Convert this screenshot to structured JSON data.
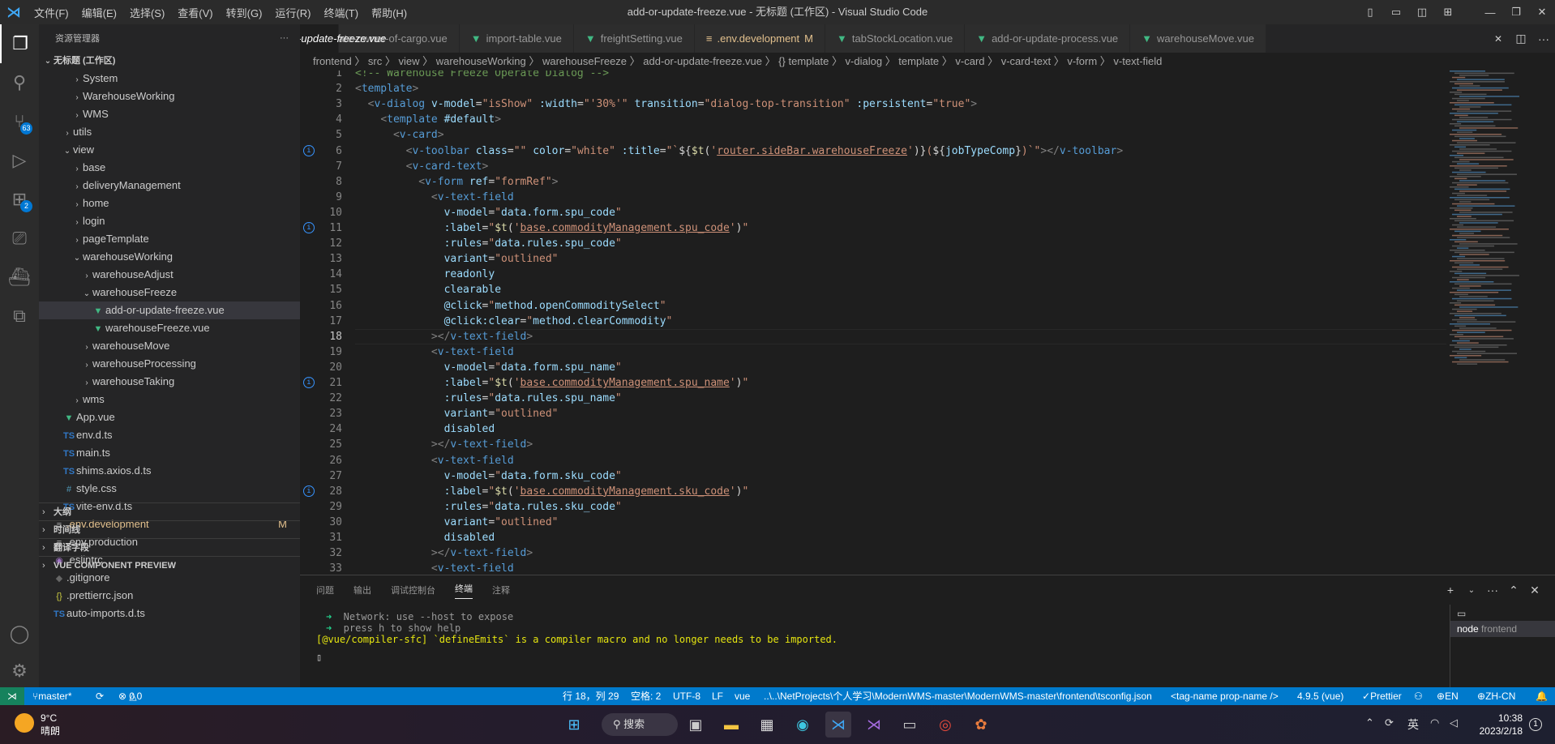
{
  "title": {
    "window": "add-or-update-freeze.vue - 无标题 (工作区) - Visual Studio Code",
    "menus": [
      "文件(F)",
      "编辑(E)",
      "选择(S)",
      "查看(V)",
      "转到(G)",
      "运行(R)",
      "终端(T)",
      "帮助(H)"
    ]
  },
  "activity": {
    "scm_badge": "63",
    "ext_badge": "2"
  },
  "sidebar": {
    "header": "资源管理器",
    "workspace": "无标题 (工作区)",
    "tree": [
      {
        "label": "System",
        "depth": 3,
        "type": "folder",
        "open": false
      },
      {
        "label": "WarehouseWorking",
        "depth": 3,
        "type": "folder",
        "open": false
      },
      {
        "label": "WMS",
        "depth": 3,
        "type": "folder",
        "open": false
      },
      {
        "label": "utils",
        "depth": 2,
        "type": "folder",
        "open": false
      },
      {
        "label": "view",
        "depth": 2,
        "type": "folder",
        "open": true
      },
      {
        "label": "base",
        "depth": 3,
        "type": "folder",
        "open": false
      },
      {
        "label": "deliveryManagement",
        "depth": 3,
        "type": "folder",
        "open": false
      },
      {
        "label": "home",
        "depth": 3,
        "type": "folder",
        "open": false
      },
      {
        "label": "login",
        "depth": 3,
        "type": "folder",
        "open": false
      },
      {
        "label": "pageTemplate",
        "depth": 3,
        "type": "folder",
        "open": false
      },
      {
        "label": "warehouseWorking",
        "depth": 3,
        "type": "folder",
        "open": true
      },
      {
        "label": "warehouseAdjust",
        "depth": 4,
        "type": "folder",
        "open": false
      },
      {
        "label": "warehouseFreeze",
        "depth": 4,
        "type": "folder",
        "open": true
      },
      {
        "label": "add-or-update-freeze.vue",
        "depth": 5,
        "type": "vue",
        "selected": true
      },
      {
        "label": "warehouseFreeze.vue",
        "depth": 5,
        "type": "vue"
      },
      {
        "label": "warehouseMove",
        "depth": 4,
        "type": "folder",
        "open": false
      },
      {
        "label": "warehouseProcessing",
        "depth": 4,
        "type": "folder",
        "open": false
      },
      {
        "label": "warehouseTaking",
        "depth": 4,
        "type": "folder",
        "open": false
      },
      {
        "label": "wms",
        "depth": 3,
        "type": "folder",
        "open": false
      },
      {
        "label": "App.vue",
        "depth": 2,
        "type": "vue"
      },
      {
        "label": "env.d.ts",
        "depth": 2,
        "type": "ts"
      },
      {
        "label": "main.ts",
        "depth": 2,
        "type": "ts"
      },
      {
        "label": "shims.axios.d.ts",
        "depth": 2,
        "type": "ts"
      },
      {
        "label": "style.css",
        "depth": 2,
        "type": "css"
      },
      {
        "label": "vite-env.d.ts",
        "depth": 2,
        "type": "ts"
      },
      {
        "label": ".env.development",
        "depth": 1,
        "type": "env",
        "mod": "M"
      },
      {
        "label": ".env.production",
        "depth": 1,
        "type": "env"
      },
      {
        "label": ".eslintrc",
        "depth": 1,
        "type": "eslint"
      },
      {
        "label": ".gitignore",
        "depth": 1,
        "type": "git"
      },
      {
        "label": ".prettierrc.json",
        "depth": 1,
        "type": "json"
      },
      {
        "label": "auto-imports.d.ts",
        "depth": 1,
        "type": "ts"
      }
    ],
    "sections": [
      "大纲",
      "时间线",
      "翻译字段",
      "VUE COMPONENT PREVIEW"
    ]
  },
  "tabs": [
    {
      "label": "pdate-owner-of-cargo.vue",
      "icon": "vue"
    },
    {
      "label": "import-table.vue",
      "icon": "vue"
    },
    {
      "label": "freightSetting.vue",
      "icon": "vue"
    },
    {
      "label": ".env.development",
      "icon": "env",
      "mod": "M"
    },
    {
      "label": "tabStockLocation.vue",
      "icon": "vue"
    },
    {
      "label": "add-or-update-process.vue",
      "icon": "vue"
    },
    {
      "label": "warehouseMove.vue",
      "icon": "vue"
    },
    {
      "label": "add-or-update-freeze.vue",
      "icon": "vue",
      "active": true
    }
  ],
  "breadcrumb": "frontend 〉 src 〉 view 〉 warehouseWorking 〉 warehouseFreeze 〉 add-or-update-freeze.vue 〉 {} template 〉 v-dialog 〉 template 〉 v-card 〉 v-card-text 〉 v-form 〉 v-text-field",
  "code": [
    {
      "n": 1,
      "h": "<span class=c>&lt;!-- Warehouse Freeze Operate Dialog --&gt;</span>"
    },
    {
      "n": 2,
      "h": "<span class=p>&lt;</span><span class=t>template</span><span class=p>&gt;</span>"
    },
    {
      "n": 3,
      "h": "  <span class=p>&lt;</span><span class=t>v-dialog</span> <span class=a>v-model</span>=<span class=s>\"isShow\"</span> <span class=a>:width</span>=<span class=s>\"'30%'\"</span> <span class=a>transition</span>=<span class=s>\"dialog-top-transition\"</span> <span class=a>:persistent</span>=<span class=s>\"true\"</span><span class=p>&gt;</span>"
    },
    {
      "n": 4,
      "h": "    <span class=p>&lt;</span><span class=t>template</span> <span class=a>#default</span><span class=p>&gt;</span>"
    },
    {
      "n": 5,
      "h": "      <span class=p>&lt;</span><span class=t>v-card</span><span class=p>&gt;</span>"
    },
    {
      "n": 6,
      "info": true,
      "h": "        <span class=p>&lt;</span><span class=t>v-toolbar</span> <span class=a>class</span>=<span class=s>\"\"</span> <span class=a>color</span>=<span class=s>\"white\"</span> <span class=a>:title</span>=<span class=s>\"`</span><span class=w>${</span><span class=y>$t</span><span class=w>(</span><span class=s>'</span><span class=f>router.sideBar.warehouseFreeze</span><span class=s>'</span><span class=w>)}</span><span class=s>(</span><span class=w>${</span><span class=a>jobTypeComp</span><span class=w>}</span><span class=s>)`\"</span><span class=p>&gt;&lt;/</span><span class=t>v-toolbar</span><span class=p>&gt;</span>"
    },
    {
      "n": 7,
      "h": "        <span class=p>&lt;</span><span class=t>v-card-text</span><span class=p>&gt;</span>"
    },
    {
      "n": 8,
      "h": "          <span class=p>&lt;</span><span class=t>v-form</span> <span class=a>ref</span>=<span class=s>\"formRef\"</span><span class=p>&gt;</span>"
    },
    {
      "n": 9,
      "h": "            <span class=p>&lt;</span><span class=t>v-text-field</span>"
    },
    {
      "n": 10,
      "h": "              <span class=a>v-model</span>=<span class=s>\"</span><span class=a>data.form.spu_code</span><span class=s>\"</span>"
    },
    {
      "n": 11,
      "info": true,
      "h": "              <span class=a>:label</span>=<span class=s>\"</span><span class=y>$t</span><span class=w>(</span><span class=s>'</span><span class=f>base.commodityManagement.spu_code</span><span class=s>'</span><span class=w>)</span><span class=s>\"</span>"
    },
    {
      "n": 12,
      "h": "              <span class=a>:rules</span>=<span class=s>\"</span><span class=a>data.rules.spu_code</span><span class=s>\"</span>"
    },
    {
      "n": 13,
      "h": "              <span class=a>variant</span>=<span class=s>\"outlined\"</span>"
    },
    {
      "n": 14,
      "h": "              <span class=a>readonly</span>"
    },
    {
      "n": 15,
      "h": "              <span class=a>clearable</span>"
    },
    {
      "n": 16,
      "h": "              <span class=a>@click</span>=<span class=s>\"</span><span class=a>method.openCommoditySelect</span><span class=s>\"</span>"
    },
    {
      "n": 17,
      "h": "              <span class=a>@click:clear</span>=<span class=s>\"</span><span class=a>method.clearCommodity</span><span class=s>\"</span>"
    },
    {
      "n": 18,
      "cur": true,
      "h": "            <span class=p>&gt;&lt;/</span><span class=t>v-text-field</span><span class=p>&gt;</span>"
    },
    {
      "n": 19,
      "h": "            <span class=p>&lt;</span><span class=t>v-text-field</span>"
    },
    {
      "n": 20,
      "h": "              <span class=a>v-model</span>=<span class=s>\"</span><span class=a>data.form.spu_name</span><span class=s>\"</span>"
    },
    {
      "n": 21,
      "info": true,
      "h": "              <span class=a>:label</span>=<span class=s>\"</span><span class=y>$t</span><span class=w>(</span><span class=s>'</span><span class=f>base.commodityManagement.spu_name</span><span class=s>'</span><span class=w>)</span><span class=s>\"</span>"
    },
    {
      "n": 22,
      "h": "              <span class=a>:rules</span>=<span class=s>\"</span><span class=a>data.rules.spu_name</span><span class=s>\"</span>"
    },
    {
      "n": 23,
      "h": "              <span class=a>variant</span>=<span class=s>\"outlined\"</span>"
    },
    {
      "n": 24,
      "h": "              <span class=a>disabled</span>"
    },
    {
      "n": 25,
      "h": "            <span class=p>&gt;&lt;/</span><span class=t>v-text-field</span><span class=p>&gt;</span>"
    },
    {
      "n": 26,
      "h": "            <span class=p>&lt;</span><span class=t>v-text-field</span>"
    },
    {
      "n": 27,
      "h": "              <span class=a>v-model</span>=<span class=s>\"</span><span class=a>data.form.sku_code</span><span class=s>\"</span>"
    },
    {
      "n": 28,
      "info": true,
      "h": "              <span class=a>:label</span>=<span class=s>\"</span><span class=y>$t</span><span class=w>(</span><span class=s>'</span><span class=f>base.commodityManagement.sku_code</span><span class=s>'</span><span class=w>)</span><span class=s>\"</span>"
    },
    {
      "n": 29,
      "h": "              <span class=a>:rules</span>=<span class=s>\"</span><span class=a>data.rules.sku_code</span><span class=s>\"</span>"
    },
    {
      "n": 30,
      "h": "              <span class=a>variant</span>=<span class=s>\"outlined\"</span>"
    },
    {
      "n": 31,
      "h": "              <span class=a>disabled</span>"
    },
    {
      "n": 32,
      "h": "            <span class=p>&gt;&lt;/</span><span class=t>v-text-field</span><span class=p>&gt;</span>"
    },
    {
      "n": 33,
      "h": "            <span class=p>&lt;</span><span class=t>v-text-field</span>"
    }
  ],
  "panel": {
    "tabs": [
      "问题",
      "输出",
      "调试控制台",
      "终端",
      "注释"
    ],
    "active_tab": "终端",
    "lines": [
      {
        "prefix": "➜",
        "text": "  Network: use --host to expose"
      },
      {
        "prefix": "➜",
        "text": "  press h to show help"
      },
      {
        "text": "[@vue/compiler-sfc] `defineEmits` is a compiler macro and no longer needs to be imported."
      }
    ],
    "terminal_name": "node",
    "terminal_cwd": "frontend"
  },
  "status": {
    "branch": "master*",
    "errors": "0",
    "warnings": "0",
    "position": "行 18，列 29",
    "spaces": "空格: 2",
    "encoding": "UTF-8",
    "eol": "LF",
    "lang": "vue",
    "tsconfig": "..\\..\\NetProjects\\个人学习\\ModernWMS-master\\ModernWMS-master\\frontend\\tsconfig.json",
    "tag": "<tag-name prop-name />",
    "version": "4.9.5 (vue)",
    "prettier": "Prettier",
    "lang_en": "EN",
    "lang_zh": "ZH-CN"
  },
  "taskbar": {
    "weather_temp": "9°C",
    "weather_desc": "晴朗",
    "search": "搜索",
    "ime": "英",
    "time": "10:38",
    "date": "2023/2/18",
    "notif": "1"
  },
  "colors": {
    "accent": "#007acc",
    "vue": "#41b883",
    "modified": "#e2c08d"
  }
}
